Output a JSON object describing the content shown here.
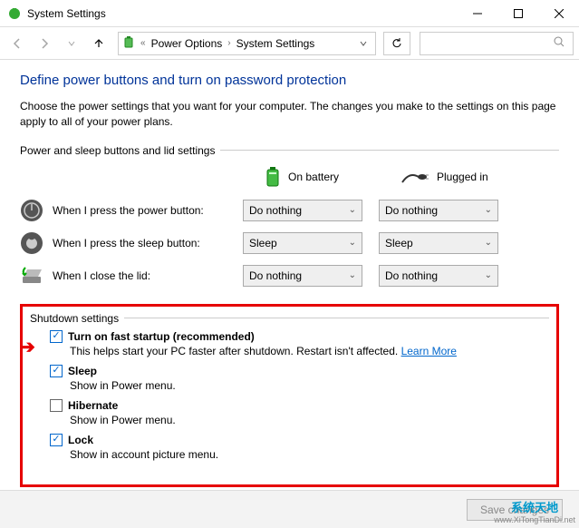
{
  "window": {
    "title": "System Settings"
  },
  "breadcrumb": {
    "item1": "Power Options",
    "item2": "System Settings"
  },
  "page": {
    "heading": "Define power buttons and turn on password protection",
    "description": "Choose the power settings that you want for your computer. The changes you make to the settings on this page apply to all of your power plans."
  },
  "section1": {
    "legend": "Power and sleep buttons and lid settings",
    "mode_battery": "On battery",
    "mode_plugged": "Plugged in",
    "rows": {
      "power": {
        "label": "When I press the power button:",
        "battery": "Do nothing",
        "plugged": "Do nothing"
      },
      "sleep": {
        "label": "When I press the sleep button:",
        "battery": "Sleep",
        "plugged": "Sleep"
      },
      "lid": {
        "label": "When I close the lid:",
        "battery": "Do nothing",
        "plugged": "Do nothing"
      }
    }
  },
  "section2": {
    "legend": "Shutdown settings",
    "fast": {
      "label": "Turn on fast startup (recommended)",
      "sub": "This helps start your PC faster after shutdown. Restart isn't affected. ",
      "link": "Learn More",
      "checked": true
    },
    "sleep": {
      "label": "Sleep",
      "sub": "Show in Power menu.",
      "checked": true
    },
    "hibernate": {
      "label": "Hibernate",
      "sub": "Show in Power menu.",
      "checked": false
    },
    "lock": {
      "label": "Lock",
      "sub": "Show in account picture menu.",
      "checked": true
    }
  },
  "footer": {
    "save": "Save changes"
  },
  "watermark": {
    "line1": "系统天地",
    "line2": "www.XiTongTianDi.net"
  }
}
